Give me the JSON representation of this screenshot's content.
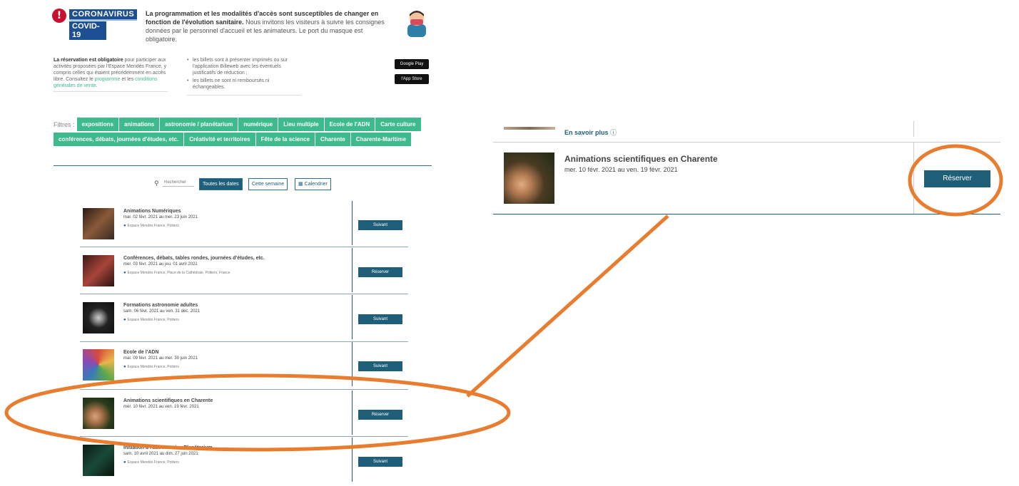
{
  "covid": {
    "icon": "info-icon",
    "tag_line1": "CORONAVIRUS",
    "tag_line2": "COVID-19",
    "headline": "La programmation et les modalités d'accès sont susceptibles de changer en fonction de l'évolution sanitaire.",
    "body": " Nous invitons les visiteurs à suivre les consignes données par le personnel d'accueil et les animateurs. Le port du masque est obligatoire."
  },
  "reservation": {
    "bold": "La réservation est obligatoire",
    "text1": " pour participer aux activités proposées par l'Espace Mendès France, y compris celles qui étaient précédemment en accès libre. Consultez le ",
    "link1": "programme",
    "text2": " et les ",
    "link2": "conditions générales de vente",
    "text3": ".",
    "bullets": [
      "les billets sont à présenter imprimés ou sur l'application Billeweb avec les éventuels justificatifs de réduction ;",
      "les billets ne sont ni remboursés ni échangeables."
    ],
    "stores": [
      "Google Play",
      "l'App Store"
    ]
  },
  "filters": {
    "label": "Filtres :",
    "chips": [
      "expositions",
      "animations",
      "astronomie / planétarium",
      "numérique",
      "Lieu multiple",
      "Ecole de l'ADN",
      "Carte culture",
      "conférences, débats, journées d'études, etc.",
      "Créativité et territoires",
      "Fête de la science",
      "Charente",
      "Charente-Maritime"
    ]
  },
  "toolbar": {
    "search_placeholder": "Rechercher",
    "all_dates": "Toutes les dates",
    "this_week": "Cette semaine",
    "calendar": "Calendrier"
  },
  "events": [
    {
      "title": "Animations Numériques",
      "dates": "mar. 02 févr. 2021 au mer. 23 juin 2021",
      "location": "Espace Mendès France, Poitiers",
      "button": "Suivant",
      "thumb_color": "#6b3a2a"
    },
    {
      "title": "Conférences, débats, tables rondes, journées d'études, etc.",
      "dates": "mer. 03 févr. 2021 au jeu. 01 avril 2021",
      "location": "Espace Mendès France, Place de la Cathédrale, Poitiers, France",
      "button": "Réserver",
      "thumb_color": "#5a2a22"
    },
    {
      "title": "Formations astronomie adultes",
      "dates": "sam. 06 févr. 2021 au ven. 31 déc. 2021",
      "location": "Espace Mendès France, Poitiers",
      "button": "Suivant",
      "thumb_color": "#2a2a2a"
    },
    {
      "title": "Ecole de l'ADN",
      "dates": "mar. 09 févr. 2021 au mer. 30 juin 2021",
      "location": "Espace Mendès France, Poitiers",
      "button": "Suivant",
      "thumb_color": "#c9a24a"
    },
    {
      "title": "Animations scientifiques en Charente",
      "dates": "mer. 10 févr. 2021 au ven. 19 févr. 2021",
      "location": "",
      "button": "Réserver",
      "thumb_color": "#3a4a2a"
    },
    {
      "title": "Initiation à l'astronomie - Planétarium",
      "dates": "sam. 10 avril 2021 au dim. 27 juin 2021",
      "location": "Espace Mendès France, Poitiers",
      "button": "Suivant",
      "thumb_color": "#1a3a2a"
    }
  ],
  "zoom": {
    "more": "En savoir plus",
    "more_icon": "info-circle-icon",
    "title": "Animations scientifiques en Charente",
    "dates": "mer. 10 févr. 2021 au ven. 19 févr. 2021",
    "button": "Réserver"
  },
  "colors": {
    "accent": "#3dbb8c",
    "primary": "#1f5f7a",
    "annotation": "#e87d2f"
  }
}
